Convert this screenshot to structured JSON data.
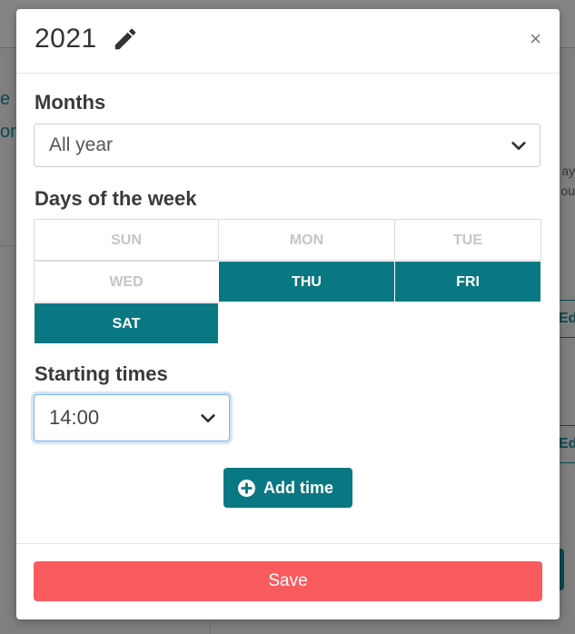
{
  "modal": {
    "title": "2021",
    "close_label": "×"
  },
  "months": {
    "label": "Months",
    "selected": "All year"
  },
  "days": {
    "label": "Days of the week",
    "items": [
      {
        "label": "SUN",
        "selected": false
      },
      {
        "label": "MON",
        "selected": false
      },
      {
        "label": "TUE",
        "selected": false
      },
      {
        "label": "WED",
        "selected": false
      },
      {
        "label": "THU",
        "selected": true
      },
      {
        "label": "FRI",
        "selected": true
      },
      {
        "label": "SAT",
        "selected": true
      }
    ]
  },
  "times": {
    "label": "Starting times",
    "selected": "14:00",
    "add_label": "Add time"
  },
  "footer": {
    "save_label": "Save"
  },
  "background": {
    "text_a": "e r",
    "text_b": "on",
    "text_c": "ay",
    "text_d": "ou",
    "btn_a": "Ed",
    "btn_b": "Ed"
  },
  "colors": {
    "accent": "#0a7882",
    "danger": "#f95b5f",
    "focus": "#7fb3e8"
  },
  "icons": {
    "title": "pencil-icon",
    "select": "chevron-down-icon",
    "add": "plus-circle-icon"
  }
}
